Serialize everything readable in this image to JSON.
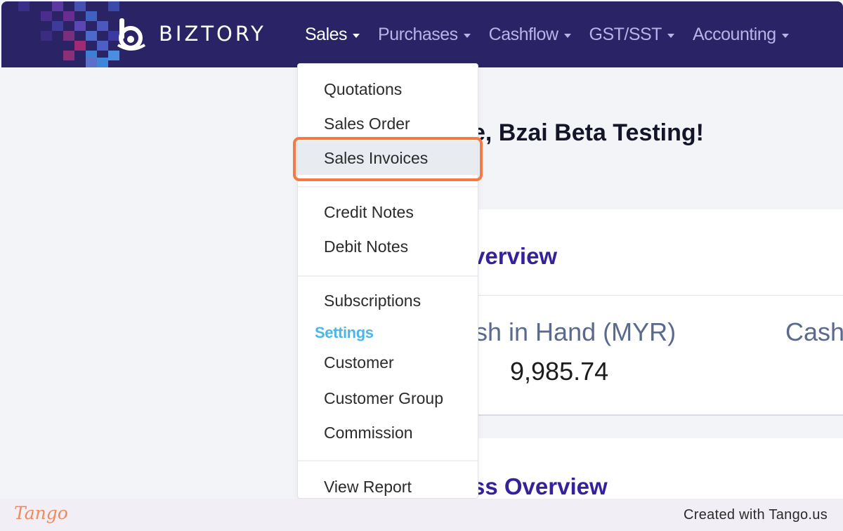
{
  "brand": {
    "name": "BIZTORY"
  },
  "nav": {
    "items": [
      {
        "label": "Sales",
        "active": true
      },
      {
        "label": "Purchases",
        "active": false
      },
      {
        "label": "Cashflow",
        "active": false
      },
      {
        "label": "GST/SST",
        "active": false
      },
      {
        "label": "Accounting",
        "active": false
      }
    ]
  },
  "dropdown": {
    "items": [
      "Quotations",
      "Sales Order",
      "Sales Invoices",
      "Credit Notes",
      "Debit Notes",
      "Subscriptions",
      "Customer",
      "Customer Group",
      "Commission",
      "View Report"
    ],
    "highlighted": "Sales Invoices",
    "settings_heading": "Settings"
  },
  "main": {
    "welcome": "e, Bzai Beta Testing!",
    "overview_title": "verview",
    "cash_in_hand_label": "sh in Hand (MYR)",
    "cash_in_hand_value": "9,985.74",
    "second_metric_label": "Cash",
    "business_overview_title": "ss Overview"
  },
  "footer": {
    "tango_logo": "Tango",
    "credit": "Created with Tango.us"
  },
  "colors": {
    "navbar": "#2a2466",
    "accent_orange": "#f47a45",
    "settings_heading": "#4cb7e6",
    "section_title": "#35219b"
  }
}
